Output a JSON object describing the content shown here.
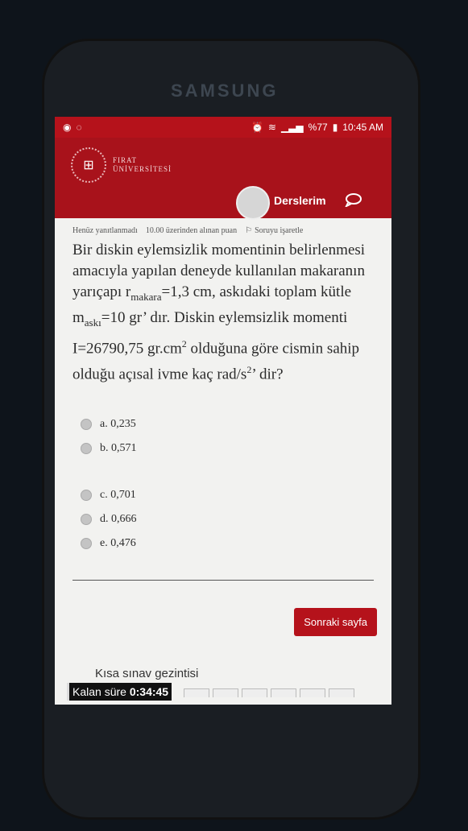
{
  "device": {
    "brand": "SAMSUNG"
  },
  "status_bar": {
    "battery": "%77",
    "time": "10:45 AM"
  },
  "header": {
    "logo_line1": "FIRAT",
    "logo_line2": "ÜNİVERSİTESİ",
    "courses_label": "Derslerim"
  },
  "question": {
    "status": "Henüz yanıtlanmadı",
    "points": "10.00 üzerinden alınan puan",
    "flag_label": "Soruyu işaretle",
    "text_1": "Bir diskin eylemsizlik momentinin belirlenmesi amacıyla yapılan deneyde kullanılan makaranın yarıçapı r",
    "sub_1": "makara",
    "text_2": "=1,3 cm, askıdaki toplam kütle m",
    "sub_2": "askı",
    "text_3": "=10 gr’ dır. Diskin eylemsizlik momenti I=26790,75 gr.cm",
    "sup_1": "2",
    "text_4": " olduğuna göre cismin sahip olduğu açısal ivme kaç rad/s",
    "sup_2": "2",
    "text_5": "’ dir?"
  },
  "options": [
    {
      "label": "a. 0,235"
    },
    {
      "label": "b. 0,571"
    },
    {
      "label": "c. 0,701"
    },
    {
      "label": "d. 0,666"
    },
    {
      "label": "e. 0,476"
    }
  ],
  "footer": {
    "next_button": "Sonraki sayfa",
    "quiz_navigation": "Kısa sınav gezintisi",
    "time_left_label": "Kalan süre",
    "time_left_value": "0:34:45"
  },
  "colors": {
    "brand_red": "#b5121b",
    "screen_bg": "#f2f2f0"
  }
}
